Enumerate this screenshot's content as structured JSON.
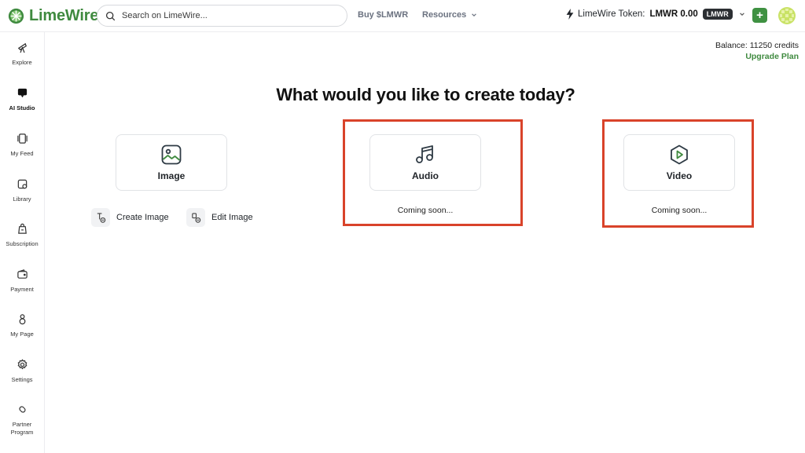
{
  "brand": {
    "name": "LimeWire",
    "color": "#3f8a3f"
  },
  "search": {
    "placeholder": "Search on LimeWire..."
  },
  "nav": {
    "buy": "Buy $LMWR",
    "resources": "Resources"
  },
  "token": {
    "label": "LimeWire Token:",
    "amount": "LMWR 0.00",
    "badge": "LMWR"
  },
  "sidebar": {
    "items": [
      {
        "label": "Explore",
        "icon": "telescope-icon"
      },
      {
        "label": "AI Studio",
        "icon": "chat-bubble-icon",
        "active": true
      },
      {
        "label": "My Feed",
        "icon": "feed-icon"
      },
      {
        "label": "Library",
        "icon": "library-icon"
      },
      {
        "label": "Subscription",
        "icon": "subscription-icon"
      },
      {
        "label": "Payment",
        "icon": "wallet-icon"
      },
      {
        "label": "My Page",
        "icon": "person-icon"
      },
      {
        "label": "Settings",
        "icon": "gear-icon"
      },
      {
        "label": "Partner Program",
        "icon": "partner-icon"
      }
    ]
  },
  "account": {
    "balance": "Balance: 11250 credits",
    "upgrade": "Upgrade Plan"
  },
  "main": {
    "title": "What would you like to create today?",
    "cards": {
      "image": {
        "label": "Image",
        "icon": "image-icon"
      },
      "audio": {
        "label": "Audio",
        "icon": "music-note-icon",
        "status": "Coming soon..."
      },
      "video": {
        "label": "Video",
        "icon": "video-play-icon",
        "status": "Coming soon..."
      }
    },
    "actions": {
      "create_image": "Create Image",
      "edit_image": "Edit Image"
    }
  },
  "colors": {
    "highlight": "#d9432a",
    "accent_button": "#3f9142",
    "badge_bg": "#2c2f33"
  }
}
